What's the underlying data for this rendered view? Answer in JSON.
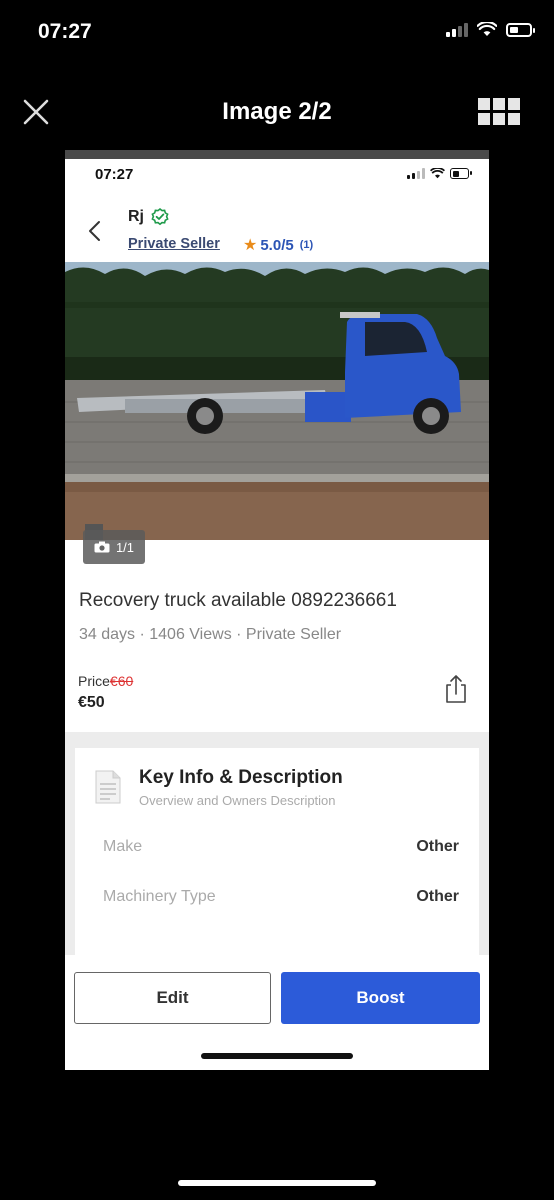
{
  "outer_status": {
    "time": "07:27"
  },
  "viewer": {
    "title": "Image 2/2",
    "close_icon": "close-icon",
    "grid_icon": "grid-icon"
  },
  "screenshot": {
    "status": {
      "time": "07:27"
    },
    "seller": {
      "name": "Rj",
      "type": "Private Seller",
      "rating": "5.0/5",
      "rating_count": "(1)",
      "verified_icon": "verified-check-icon"
    },
    "photo": {
      "counter": "1/1",
      "camera_icon": "camera-icon"
    },
    "listing": {
      "title": "Recovery truck available 0892236661",
      "meta": "34 days · 1406 Views · Private Seller",
      "price_label": "Price",
      "price_old": "€60",
      "price_now": "€50"
    },
    "key_info": {
      "title": "Key Info & Description",
      "subtitle": "Overview and Owners Description",
      "rows": [
        {
          "label": "Make",
          "value": "Other"
        },
        {
          "label": "Machinery Type",
          "value": "Other"
        }
      ]
    },
    "actions": {
      "edit_label": "Edit",
      "boost_label": "Boost"
    },
    "colors": {
      "accent": "#2c5bd9",
      "rating": "#2b54b5",
      "star": "#e98b1a",
      "verified": "#1e9a4a"
    }
  }
}
